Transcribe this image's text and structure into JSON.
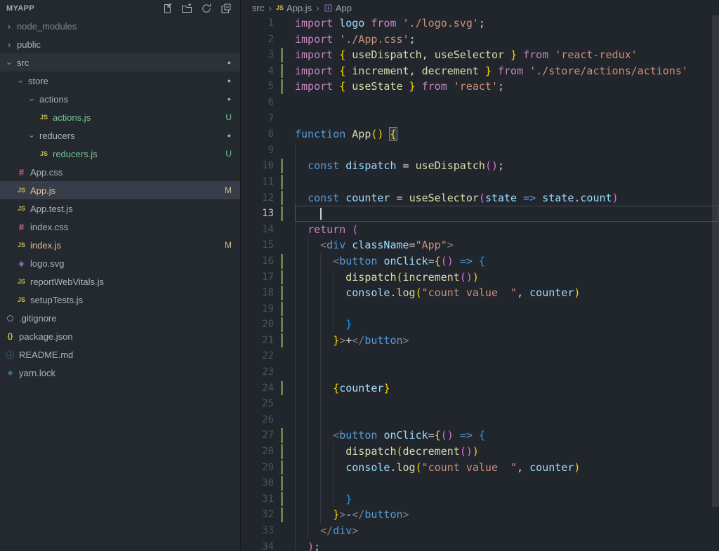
{
  "sidebar": {
    "title": "MYAPP",
    "actions": [
      {
        "name": "new-file-icon"
      },
      {
        "name": "new-folder-icon"
      },
      {
        "name": "refresh-explorer-icon"
      },
      {
        "name": "collapse-folders-icon"
      }
    ],
    "tree": [
      {
        "label": "node_modules",
        "indent": 0,
        "kind": "folder",
        "expanded": false,
        "status": "ignored"
      },
      {
        "label": "public",
        "indent": 0,
        "kind": "folder",
        "expanded": false
      },
      {
        "label": "src",
        "indent": 0,
        "kind": "folder",
        "expanded": true,
        "dot": true,
        "highlight": true
      },
      {
        "label": "store",
        "indent": 1,
        "kind": "folder",
        "expanded": true,
        "dot": true
      },
      {
        "label": "actions",
        "indent": 2,
        "kind": "folder",
        "expanded": true,
        "dot": true
      },
      {
        "label": "actions.js",
        "indent": 3,
        "kind": "js",
        "badge": "U",
        "status": "untracked"
      },
      {
        "label": "reducers",
        "indent": 2,
        "kind": "folder",
        "expanded": true,
        "dot": true
      },
      {
        "label": "reducers.js",
        "indent": 3,
        "kind": "js",
        "badge": "U",
        "status": "untracked"
      },
      {
        "label": "App.css",
        "indent": 1,
        "kind": "css"
      },
      {
        "label": "App.js",
        "indent": 1,
        "kind": "js",
        "badge": "M",
        "status": "modified",
        "selected": true
      },
      {
        "label": "App.test.js",
        "indent": 1,
        "kind": "js"
      },
      {
        "label": "index.css",
        "indent": 1,
        "kind": "css"
      },
      {
        "label": "index.js",
        "indent": 1,
        "kind": "js",
        "badge": "M",
        "status": "modified"
      },
      {
        "label": "logo.svg",
        "indent": 1,
        "kind": "svg"
      },
      {
        "label": "reportWebVitals.js",
        "indent": 1,
        "kind": "js"
      },
      {
        "label": "setupTests.js",
        "indent": 1,
        "kind": "js"
      },
      {
        "label": ".gitignore",
        "indent": 0,
        "kind": "git"
      },
      {
        "label": "package.json",
        "indent": 0,
        "kind": "json"
      },
      {
        "label": "README.md",
        "indent": 0,
        "kind": "md"
      },
      {
        "label": "yarn.lock",
        "indent": 0,
        "kind": "lock"
      }
    ]
  },
  "icons": {
    "js": {
      "glyph": "JS",
      "color": "#ccbb4e"
    },
    "css": {
      "glyph": "#",
      "color": "#c76b9b"
    },
    "json": {
      "glyph": "{}",
      "color": "#cbcb41"
    },
    "md": {
      "glyph": "ⓘ",
      "color": "#519aba"
    },
    "svg": {
      "glyph": "◈",
      "color": "#a074c4"
    },
    "lock": {
      "glyph": "◆",
      "color": "#2b7489"
    },
    "git": {
      "glyph": "circle",
      "color": "#8a919c"
    },
    "folder-collapsed": {
      "glyph": "›"
    },
    "folder-expanded": {
      "glyph": "› rotated 90deg"
    }
  },
  "breadcrumb": {
    "items": [
      {
        "label": "src",
        "icon": null
      },
      {
        "label": "App.js",
        "icon": "js"
      },
      {
        "label": "App",
        "icon": "symbol-class"
      }
    ]
  },
  "editor": {
    "current_line": 13,
    "cursor_col": 4,
    "lines": [
      {
        "n": 1,
        "g": 0,
        "t": [
          [
            "kw",
            "import "
          ],
          [
            "vr",
            "logo"
          ],
          [
            "pl",
            " "
          ],
          [
            "kw",
            "from"
          ],
          [
            "pl",
            " "
          ],
          [
            "str",
            "'./logo.svg'"
          ],
          [
            "pl",
            ";"
          ]
        ]
      },
      {
        "n": 2,
        "g": 0,
        "t": [
          [
            "kw",
            "import "
          ],
          [
            "str",
            "'./App.css'"
          ],
          [
            "pl",
            ";"
          ]
        ]
      },
      {
        "n": 3,
        "g": 0,
        "chg": true,
        "t": [
          [
            "kw",
            "import "
          ],
          [
            "b1",
            "{"
          ],
          [
            "pl",
            " "
          ],
          [
            "fn",
            "useDispatch"
          ],
          [
            "pl",
            ", "
          ],
          [
            "fn",
            "useSelector"
          ],
          [
            "pl",
            " "
          ],
          [
            "b1",
            "}"
          ],
          [
            "pl",
            " "
          ],
          [
            "kw",
            "from"
          ],
          [
            "pl",
            " "
          ],
          [
            "str",
            "'react-redux'"
          ]
        ]
      },
      {
        "n": 4,
        "g": 0,
        "chg": true,
        "t": [
          [
            "kw",
            "import "
          ],
          [
            "b1",
            "{"
          ],
          [
            "pl",
            " "
          ],
          [
            "fn",
            "increment"
          ],
          [
            "pl",
            ", "
          ],
          [
            "fn",
            "decrement"
          ],
          [
            "pl",
            " "
          ],
          [
            "b1",
            "}"
          ],
          [
            "pl",
            " "
          ],
          [
            "kw",
            "from"
          ],
          [
            "pl",
            " "
          ],
          [
            "str",
            "'./store/actions/actions'"
          ]
        ]
      },
      {
        "n": 5,
        "g": 0,
        "chg": true,
        "t": [
          [
            "kw",
            "import "
          ],
          [
            "b1",
            "{"
          ],
          [
            "pl",
            " "
          ],
          [
            "fn",
            "useState"
          ],
          [
            "pl",
            " "
          ],
          [
            "b1",
            "}"
          ],
          [
            "pl",
            " "
          ],
          [
            "kw",
            "from"
          ],
          [
            "pl",
            " "
          ],
          [
            "str",
            "'react'"
          ],
          [
            "pl",
            ";"
          ]
        ]
      },
      {
        "n": 6,
        "g": 0,
        "t": []
      },
      {
        "n": 7,
        "g": 0,
        "t": []
      },
      {
        "n": 8,
        "g": 0,
        "t": [
          [
            "st",
            "function"
          ],
          [
            "pl",
            " "
          ],
          [
            "fn",
            "App"
          ],
          [
            "b1",
            "()"
          ],
          [
            "pl",
            " "
          ],
          [
            "b1 match",
            "{"
          ]
        ]
      },
      {
        "n": 9,
        "g": 1,
        "t": []
      },
      {
        "n": 10,
        "g": 1,
        "chg": true,
        "t": [
          [
            "pl",
            "  "
          ],
          [
            "st",
            "const"
          ],
          [
            "pl",
            " "
          ],
          [
            "vr",
            "dispatch"
          ],
          [
            "op",
            " = "
          ],
          [
            "fn",
            "useDispatch"
          ],
          [
            "b2",
            "()"
          ],
          [
            "pl",
            ";"
          ]
        ]
      },
      {
        "n": 11,
        "g": 1,
        "chg": true,
        "t": []
      },
      {
        "n": 12,
        "g": 1,
        "chg": true,
        "t": [
          [
            "pl",
            "  "
          ],
          [
            "st",
            "const"
          ],
          [
            "pl",
            " "
          ],
          [
            "vr",
            "counter"
          ],
          [
            "op",
            " = "
          ],
          [
            "fn",
            "useSelector"
          ],
          [
            "b2",
            "("
          ],
          [
            "vr",
            "state"
          ],
          [
            "pl",
            " "
          ],
          [
            "st",
            "=>"
          ],
          [
            "pl",
            " "
          ],
          [
            "vr",
            "state"
          ],
          [
            "pl",
            "."
          ],
          [
            "vr",
            "count"
          ],
          [
            "b2",
            ")"
          ]
        ]
      },
      {
        "n": 13,
        "g": 1,
        "chg": true,
        "t": []
      },
      {
        "n": 14,
        "g": 1,
        "t": [
          [
            "pl",
            "  "
          ],
          [
            "kw",
            "return"
          ],
          [
            "pl",
            " "
          ],
          [
            "b2",
            "("
          ]
        ]
      },
      {
        "n": 15,
        "g": 2,
        "t": [
          [
            "pl",
            "    "
          ],
          [
            "tp",
            "<"
          ],
          [
            "tag",
            "div"
          ],
          [
            "pl",
            " "
          ],
          [
            "attr",
            "className"
          ],
          [
            "op",
            "="
          ],
          [
            "str",
            "\"App\""
          ],
          [
            "tp",
            ">"
          ]
        ]
      },
      {
        "n": 16,
        "g": 3,
        "chg": true,
        "t": [
          [
            "pl",
            "      "
          ],
          [
            "tp",
            "<"
          ],
          [
            "tag",
            "button"
          ],
          [
            "pl",
            " "
          ],
          [
            "attr",
            "onClick"
          ],
          [
            "op",
            "="
          ],
          [
            "b1",
            "{"
          ],
          [
            "b2",
            "()"
          ],
          [
            "pl",
            " "
          ],
          [
            "st",
            "=>"
          ],
          [
            "pl",
            " "
          ],
          [
            "b3",
            "{"
          ]
        ]
      },
      {
        "n": 17,
        "g": 4,
        "chg": true,
        "t": [
          [
            "pl",
            "        "
          ],
          [
            "fn",
            "dispatch"
          ],
          [
            "b1",
            "("
          ],
          [
            "fn",
            "increment"
          ],
          [
            "b2",
            "()"
          ],
          [
            "b1",
            ")"
          ]
        ]
      },
      {
        "n": 18,
        "g": 4,
        "chg": true,
        "t": [
          [
            "pl",
            "        "
          ],
          [
            "vr",
            "console"
          ],
          [
            "pl",
            "."
          ],
          [
            "fn",
            "log"
          ],
          [
            "b1",
            "("
          ],
          [
            "str",
            "\"count value  \""
          ],
          [
            "pl",
            ", "
          ],
          [
            "vr",
            "counter"
          ],
          [
            "b1",
            ")"
          ]
        ]
      },
      {
        "n": 19,
        "g": 4,
        "chg": true,
        "t": []
      },
      {
        "n": 20,
        "g": 4,
        "chg": true,
        "t": [
          [
            "pl",
            "        "
          ],
          [
            "b3",
            "}"
          ]
        ]
      },
      {
        "n": 21,
        "g": 3,
        "chg": true,
        "t": [
          [
            "pl",
            "      "
          ],
          [
            "b1",
            "}"
          ],
          [
            "tp",
            ">"
          ],
          [
            "pl",
            "+"
          ],
          [
            "tp",
            "</"
          ],
          [
            "tag",
            "button"
          ],
          [
            "tp",
            ">"
          ]
        ]
      },
      {
        "n": 22,
        "g": 3,
        "t": []
      },
      {
        "n": 23,
        "g": 3,
        "t": []
      },
      {
        "n": 24,
        "g": 3,
        "chg": true,
        "t": [
          [
            "pl",
            "      "
          ],
          [
            "b1",
            "{"
          ],
          [
            "vr",
            "counter"
          ],
          [
            "b1",
            "}"
          ]
        ]
      },
      {
        "n": 25,
        "g": 3,
        "t": []
      },
      {
        "n": 26,
        "g": 3,
        "t": []
      },
      {
        "n": 27,
        "g": 3,
        "chg": true,
        "t": [
          [
            "pl",
            "      "
          ],
          [
            "tp",
            "<"
          ],
          [
            "tag",
            "button"
          ],
          [
            "pl",
            " "
          ],
          [
            "attr",
            "onClick"
          ],
          [
            "op",
            "="
          ],
          [
            "b1",
            "{"
          ],
          [
            "b2",
            "()"
          ],
          [
            "pl",
            " "
          ],
          [
            "st",
            "=>"
          ],
          [
            "pl",
            " "
          ],
          [
            "b3",
            "{"
          ]
        ]
      },
      {
        "n": 28,
        "g": 4,
        "chg": true,
        "t": [
          [
            "pl",
            "        "
          ],
          [
            "fn",
            "dispatch"
          ],
          [
            "b1",
            "("
          ],
          [
            "fn",
            "decrement"
          ],
          [
            "b2",
            "()"
          ],
          [
            "b1",
            ")"
          ]
        ]
      },
      {
        "n": 29,
        "g": 4,
        "chg": true,
        "t": [
          [
            "pl",
            "        "
          ],
          [
            "vr",
            "console"
          ],
          [
            "pl",
            "."
          ],
          [
            "fn",
            "log"
          ],
          [
            "b1",
            "("
          ],
          [
            "str",
            "\"count value  \""
          ],
          [
            "pl",
            ", "
          ],
          [
            "vr",
            "counter"
          ],
          [
            "b1",
            ")"
          ]
        ]
      },
      {
        "n": 30,
        "g": 4,
        "chg": true,
        "t": []
      },
      {
        "n": 31,
        "g": 4,
        "chg": true,
        "t": [
          [
            "pl",
            "        "
          ],
          [
            "b3",
            "}"
          ]
        ]
      },
      {
        "n": 32,
        "g": 3,
        "chg": true,
        "t": [
          [
            "pl",
            "      "
          ],
          [
            "b1",
            "}"
          ],
          [
            "tp",
            ">"
          ],
          [
            "pl",
            "-"
          ],
          [
            "tp",
            "</"
          ],
          [
            "tag",
            "button"
          ],
          [
            "tp",
            ">"
          ]
        ]
      },
      {
        "n": 33,
        "g": 2,
        "t": [
          [
            "pl",
            "    "
          ],
          [
            "tp",
            "</"
          ],
          [
            "tag",
            "div"
          ],
          [
            "tp",
            ">"
          ]
        ]
      },
      {
        "n": 34,
        "g": 1,
        "t": [
          [
            "pl",
            "  "
          ],
          [
            "b2",
            ")"
          ],
          [
            "pl",
            ";"
          ]
        ]
      }
    ]
  },
  "colors": {
    "sidebar_bg": "#24282f",
    "editor_bg": "#21252c",
    "selected_row": "#373d49",
    "badge_untracked": "#73c991",
    "badge_modified": "#e2c08d",
    "git_added_bar": "#6f9e56",
    "keyword": "#c586c0",
    "storage": "#569cd6",
    "string": "#ce9178",
    "function": "#dcdcaa",
    "variable": "#9cdcfe"
  }
}
